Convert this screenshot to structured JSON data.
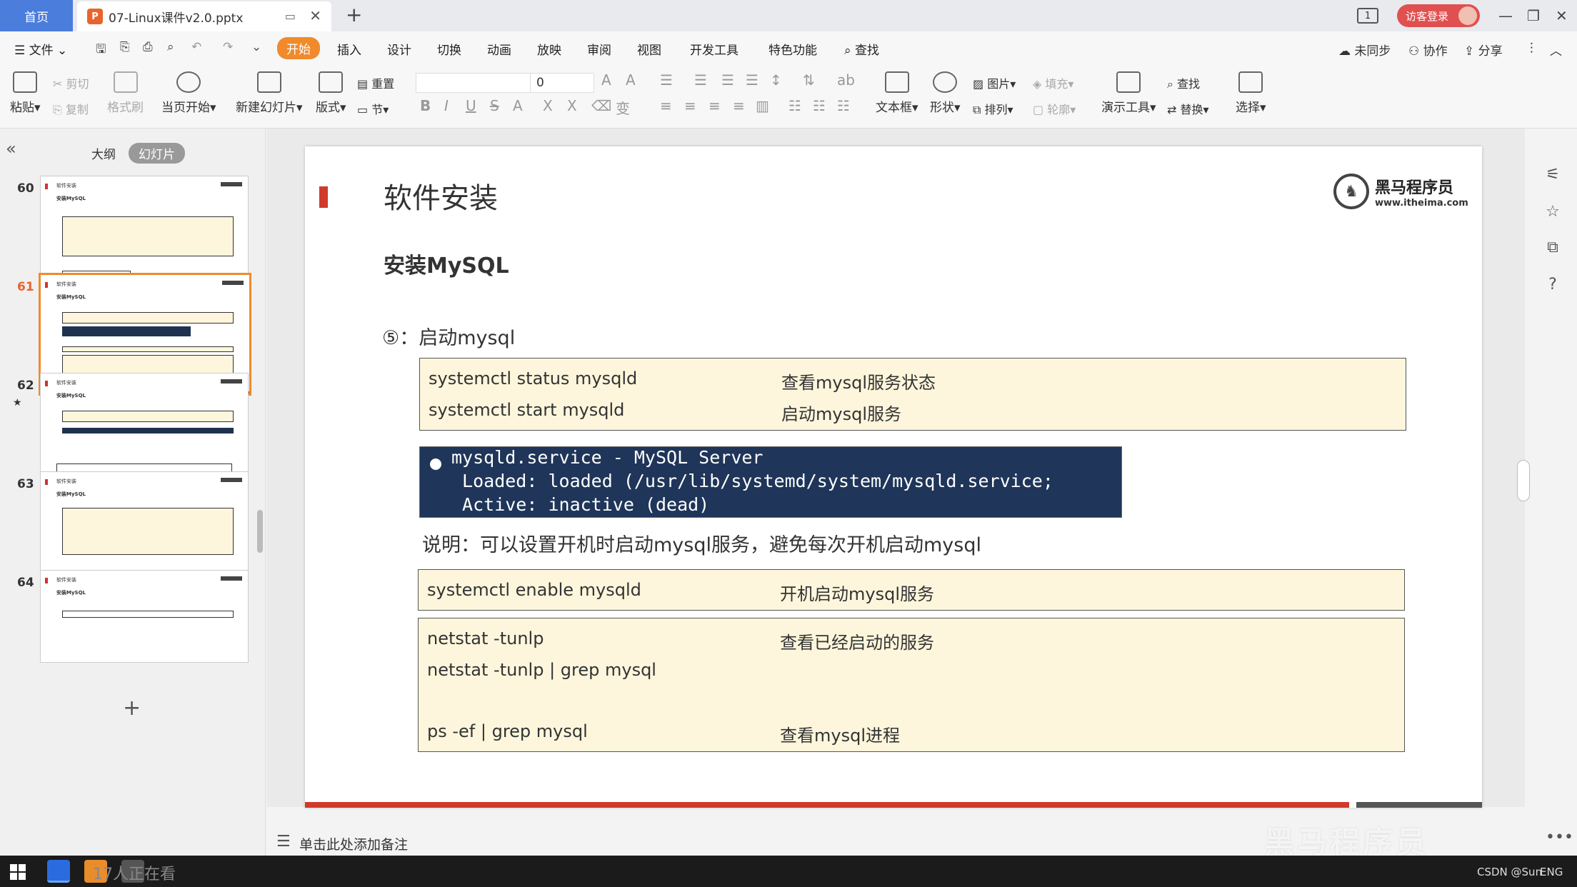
{
  "tabs": {
    "home": "首页",
    "document": "07-Linux课件v2.0.pptx",
    "doc_icon_letter": "P"
  },
  "titlebar": {
    "badge": "1",
    "guest_login": "访客登录"
  },
  "menu": {
    "file": "文件",
    "items": [
      "开始",
      "插入",
      "设计",
      "切换",
      "动画",
      "放映",
      "审阅",
      "视图",
      "开发工具",
      "特色功能"
    ],
    "search": "查找",
    "not_synced": "未同步",
    "collaborate": "协作",
    "share": "分享"
  },
  "ribbon": {
    "paste": "粘贴",
    "cut": "剪切",
    "copy": "复制",
    "format_painter": "格式刷",
    "play_from_current": "当页开始",
    "new_slide": "新建幻灯片",
    "layout": "版式",
    "reset": "重置",
    "section": "节",
    "font_size": "0",
    "textbox": "文本框",
    "shape": "形状",
    "picture": "图片",
    "fill": "填充",
    "arrange": "排列",
    "outline": "轮廓",
    "presentation_tools": "演示工具",
    "find": "查找",
    "replace": "替换",
    "select": "选择"
  },
  "left_panel": {
    "tab_outline": "大纲",
    "tab_slides": "幻灯片",
    "thumbnails": [
      {
        "num": "60",
        "title": "软件安装",
        "sub": "安装MySQL"
      },
      {
        "num": "61",
        "title": "软件安装",
        "sub": "安装MySQL"
      },
      {
        "num": "62",
        "title": "软件安装",
        "sub": "安装MySQL"
      },
      {
        "num": "63",
        "title": "软件安装",
        "sub": "安装MySQL"
      },
      {
        "num": "64",
        "title": "软件安装",
        "sub": "安装MySQL"
      }
    ],
    "selected": "61"
  },
  "slide": {
    "title": "软件安装",
    "logo_cn": "黑马程序员",
    "logo_url": "www.itheima.com",
    "subtitle": "安装MySQL",
    "step": "⑤：启动mysql",
    "box1": [
      {
        "cmd": "systemctl status mysqld",
        "desc": "查看mysql服务状态"
      },
      {
        "cmd": "systemctl start mysqld",
        "desc": "启动mysql服务"
      }
    ],
    "terminal": [
      "mysqld.service - MySQL Server",
      " Loaded: loaded (/usr/lib/systemd/system/mysqld.service;",
      " Active: inactive (dead)"
    ],
    "note": "说明：可以设置开机时启动mysql服务，避免每次开机启动mysql",
    "box2": [
      {
        "cmd": "systemctl enable mysqld",
        "desc": "开机启动mysql服务"
      }
    ],
    "box3": [
      {
        "cmd": "netstat -tunlp",
        "desc": "查看已经启动的服务"
      },
      {
        "cmd": "netstat -tunlp | grep mysql",
        "desc": ""
      },
      {
        "cmd": "ps -ef | grep mysql",
        "desc": "查看mysql进程"
      }
    ]
  },
  "notes_bar": {
    "placeholder": "单击此处添加备注"
  },
  "watermark": "黑马程序员",
  "taskbar": {
    "viewers": "17人正在看",
    "tray_source": "CSDN @Sun",
    "lang": "ENG"
  },
  "colors": {
    "accent_orange": "#f08a2c",
    "slide_red": "#d03a2a",
    "terminal_bg": "#1f3559",
    "box_bg": "#fdf6dc"
  }
}
